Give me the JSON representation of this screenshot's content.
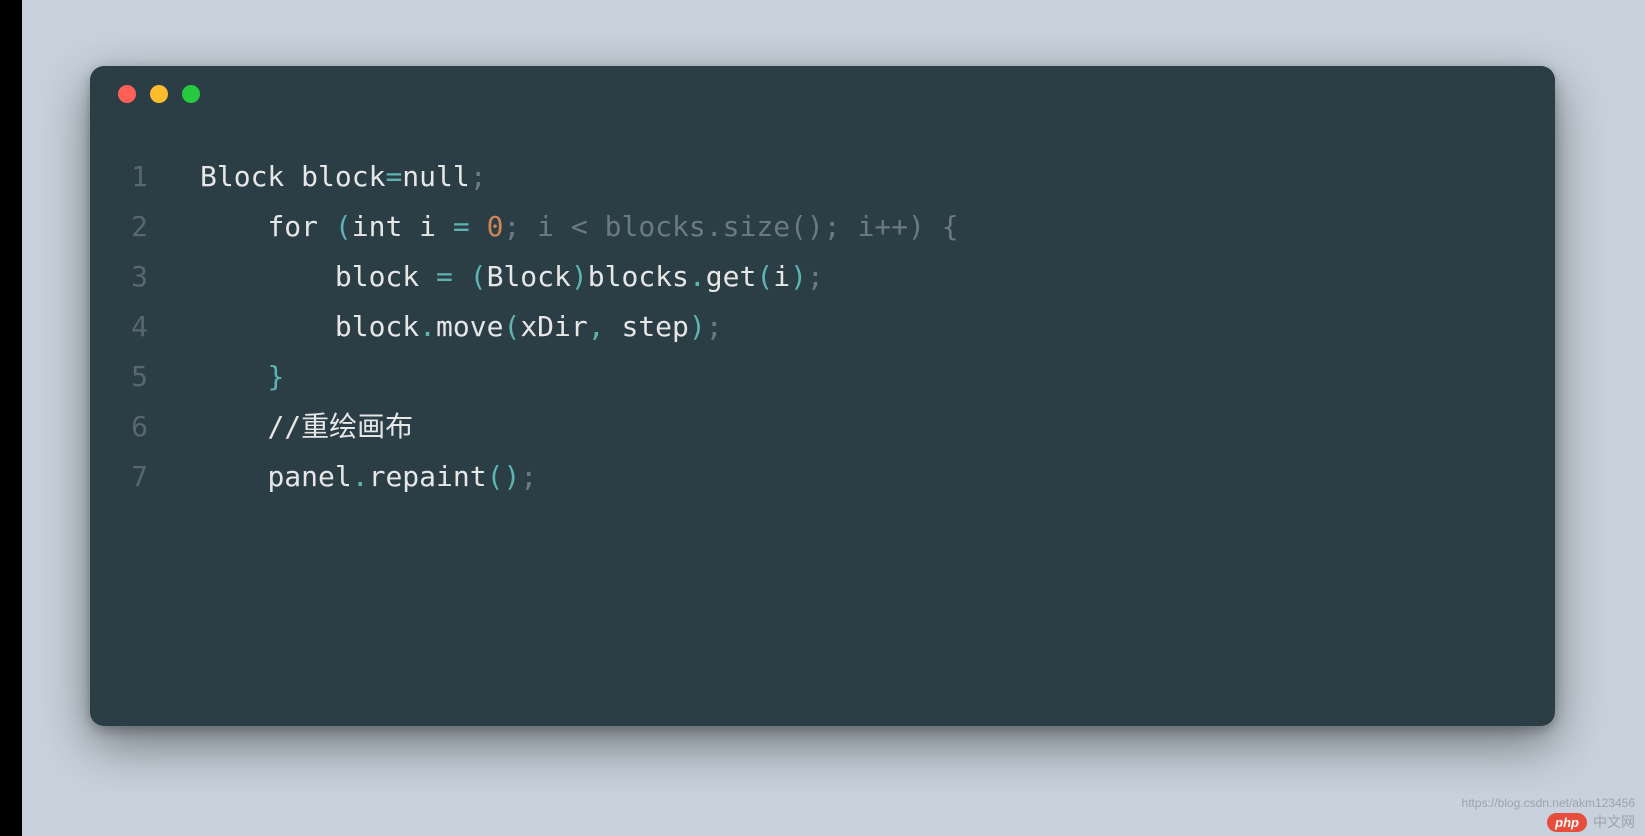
{
  "window": {
    "traffic_lights": [
      "red",
      "yellow",
      "green"
    ]
  },
  "code": {
    "lines": [
      {
        "n": "1",
        "tokens": [
          {
            "cls": "code",
            "t": "Block block"
          },
          {
            "cls": "tok-punc",
            "t": "="
          },
          {
            "cls": "tok-lit-null",
            "t": "null"
          },
          {
            "cls": "tok-dim",
            "t": ";"
          }
        ],
        "indent": 0
      },
      {
        "n": "2",
        "tokens": [
          {
            "cls": "tok-kw",
            "t": "for"
          },
          {
            "cls": "code",
            "t": " "
          },
          {
            "cls": "tok-punc",
            "t": "("
          },
          {
            "cls": "tok-kw",
            "t": "int"
          },
          {
            "cls": "code",
            "t": " i "
          },
          {
            "cls": "tok-punc",
            "t": "="
          },
          {
            "cls": "code",
            "t": " "
          },
          {
            "cls": "tok-num",
            "t": "0"
          },
          {
            "cls": "tok-dim",
            "t": "; i < blocks.size(); i++) {"
          }
        ],
        "indent": 1
      },
      {
        "n": "3",
        "tokens": [
          {
            "cls": "code",
            "t": "block "
          },
          {
            "cls": "tok-punc",
            "t": "="
          },
          {
            "cls": "code",
            "t": " "
          },
          {
            "cls": "tok-punc",
            "t": "("
          },
          {
            "cls": "code",
            "t": "Block"
          },
          {
            "cls": "tok-punc",
            "t": ")"
          },
          {
            "cls": "code",
            "t": "blocks"
          },
          {
            "cls": "tok-punc",
            "t": "."
          },
          {
            "cls": "tok-fn",
            "t": "get"
          },
          {
            "cls": "tok-punc",
            "t": "("
          },
          {
            "cls": "code",
            "t": "i"
          },
          {
            "cls": "tok-punc",
            "t": ")"
          },
          {
            "cls": "tok-dim",
            "t": ";"
          }
        ],
        "indent": 2
      },
      {
        "n": "4",
        "tokens": [
          {
            "cls": "code",
            "t": "block"
          },
          {
            "cls": "tok-punc",
            "t": "."
          },
          {
            "cls": "tok-fn",
            "t": "move"
          },
          {
            "cls": "tok-punc",
            "t": "("
          },
          {
            "cls": "code",
            "t": "xDir"
          },
          {
            "cls": "tok-punc",
            "t": ","
          },
          {
            "cls": "code",
            "t": " step"
          },
          {
            "cls": "tok-punc",
            "t": ")"
          },
          {
            "cls": "tok-dim",
            "t": ";"
          }
        ],
        "indent": 2
      },
      {
        "n": "5",
        "tokens": [
          {
            "cls": "tok-punc",
            "t": "}"
          }
        ],
        "indent": 1
      },
      {
        "n": "6",
        "tokens": [
          {
            "cls": "tok-comment",
            "t": "//重绘画布"
          }
        ],
        "indent": 1
      },
      {
        "n": "7",
        "tokens": [
          {
            "cls": "code",
            "t": "panel"
          },
          {
            "cls": "tok-punc",
            "t": "."
          },
          {
            "cls": "tok-fn",
            "t": "repaint"
          },
          {
            "cls": "tok-punc",
            "t": "()"
          },
          {
            "cls": "tok-dim",
            "t": ";"
          }
        ],
        "indent": 1
      }
    ],
    "indent_unit": "    "
  },
  "watermark": {
    "badge": "php",
    "text": "中文网",
    "url": "https://blog.csdn.net/akm123456"
  }
}
